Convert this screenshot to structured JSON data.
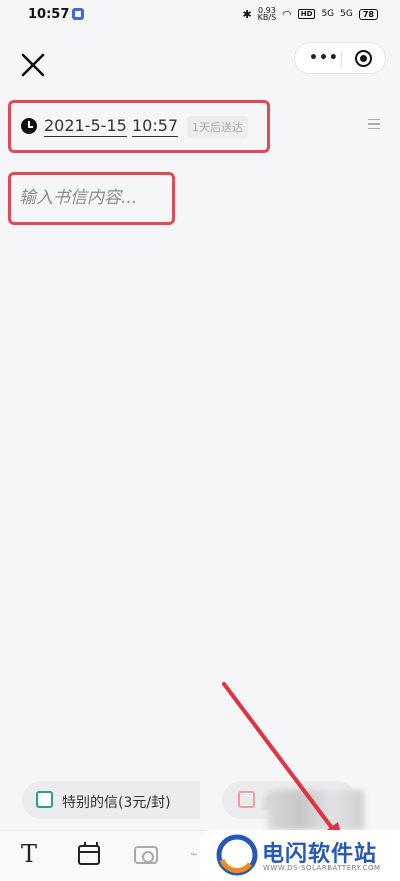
{
  "status_bar": {
    "time": "10:57",
    "net_speed_value": "0.93",
    "net_speed_unit": "KB/S",
    "signal_1": "5G",
    "signal_2": "5G",
    "battery": "78"
  },
  "header": {
    "close_icon": "close-icon",
    "capsule_more_icon": "more-dots-icon",
    "capsule_target_icon": "target-icon"
  },
  "schedule": {
    "date": "2021-5-15",
    "time": "10:57",
    "hint": "1天后送达"
  },
  "editor": {
    "placeholder": "输入书信内容..."
  },
  "options": {
    "special_letter_label": "特别的信(3元/封)",
    "second_option_label": "选"
  },
  "toolbar": {
    "text_tool_label": "T"
  },
  "watermark": {
    "title": "电闪软件站",
    "subtitle": "WWW.DS-SOLARBATTERY.COM"
  },
  "colors": {
    "highlight_border": "#de4a55",
    "checkbox_green": "#2aa17f",
    "watermark_blue": "#2658b5",
    "arrow_red": "#e0323f",
    "send_yellow": "#f5d84a"
  }
}
